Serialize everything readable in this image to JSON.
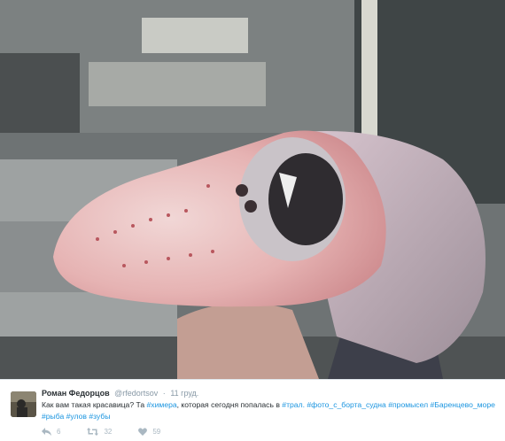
{
  "tweet": {
    "name": "Роман Федорцов",
    "handle": "@rfedortsov",
    "separator": "·",
    "time": "11 груд.",
    "text_before": "Как вам такая красавица? Та ",
    "hashtag_chimera": "#химера",
    "text_middle": ", которая сегодня попалась в ",
    "hashtags_line": [
      "#трал.",
      "#фото_с_борта_судна",
      "#промысел",
      "#Баренцево_море",
      "#рыба",
      "#улов",
      "#зубы"
    ],
    "actions": {
      "reply_count": "6",
      "retweet_count": "32",
      "like_count": "59"
    }
  },
  "colors": {
    "link": "#1b95e0",
    "text": "#292f33",
    "muted": "#8899a6",
    "icon": "#aab8c2"
  },
  "icons": [
    "reply-icon",
    "retweet-icon",
    "heart-icon"
  ]
}
